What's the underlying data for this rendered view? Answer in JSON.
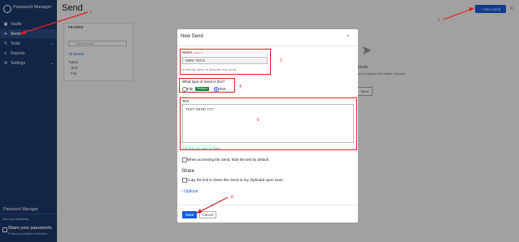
{
  "sidebar": {
    "app_name": "Password Manager",
    "items": [
      {
        "label": "Vaults",
        "icon": "vault-icon"
      },
      {
        "label": "Send",
        "icon": "send-icon",
        "active": true
      },
      {
        "label": "Tools",
        "icon": "tools-icon",
        "chevron": true
      },
      {
        "label": "Reports",
        "icon": "reports-icon"
      },
      {
        "label": "Settings",
        "icon": "gear-icon",
        "chevron": true
      }
    ],
    "bottom_label": "Password Manager",
    "more_from": "More from Bitwarden",
    "share_title": "Share your passwords",
    "share_sub": "Protect your family or business"
  },
  "header": {
    "title": "Send",
    "new_send_label": "+ New Send"
  },
  "filters": {
    "title": "FILTERS",
    "search_placeholder": "Search Sends",
    "all_sends": "All Sends",
    "types_label": "Types",
    "types": [
      "Text",
      "File"
    ]
  },
  "empty_state": {
    "title": "Sends",
    "description": "ile encrypted information anyone.",
    "button": "Send"
  },
  "modal": {
    "title": "New Send",
    "close": "×",
    "name_label": "Name",
    "name_required": "(required)",
    "name_value": "MMD TECH",
    "name_hint": "A friendly name to describe this Send.",
    "type_question": "What type of Send is this?",
    "type_file": "File",
    "premium_badge": "Premium",
    "type_text": "Text",
    "text_label": "Text",
    "text_value": "TEST SEND TXT",
    "text_hint": "The text you want to Send.",
    "hide_text": "When accessing the Send, hide the text by default",
    "share_heading": "Share",
    "copy_link": "Copy the link to share this Send to my clipboard upon save.",
    "options": "Options",
    "save": "Save",
    "cancel": "Cancel"
  },
  "annotations": {
    "color": "#e02020",
    "labels": [
      "1",
      "2",
      "3",
      "4",
      "5",
      "6"
    ]
  }
}
